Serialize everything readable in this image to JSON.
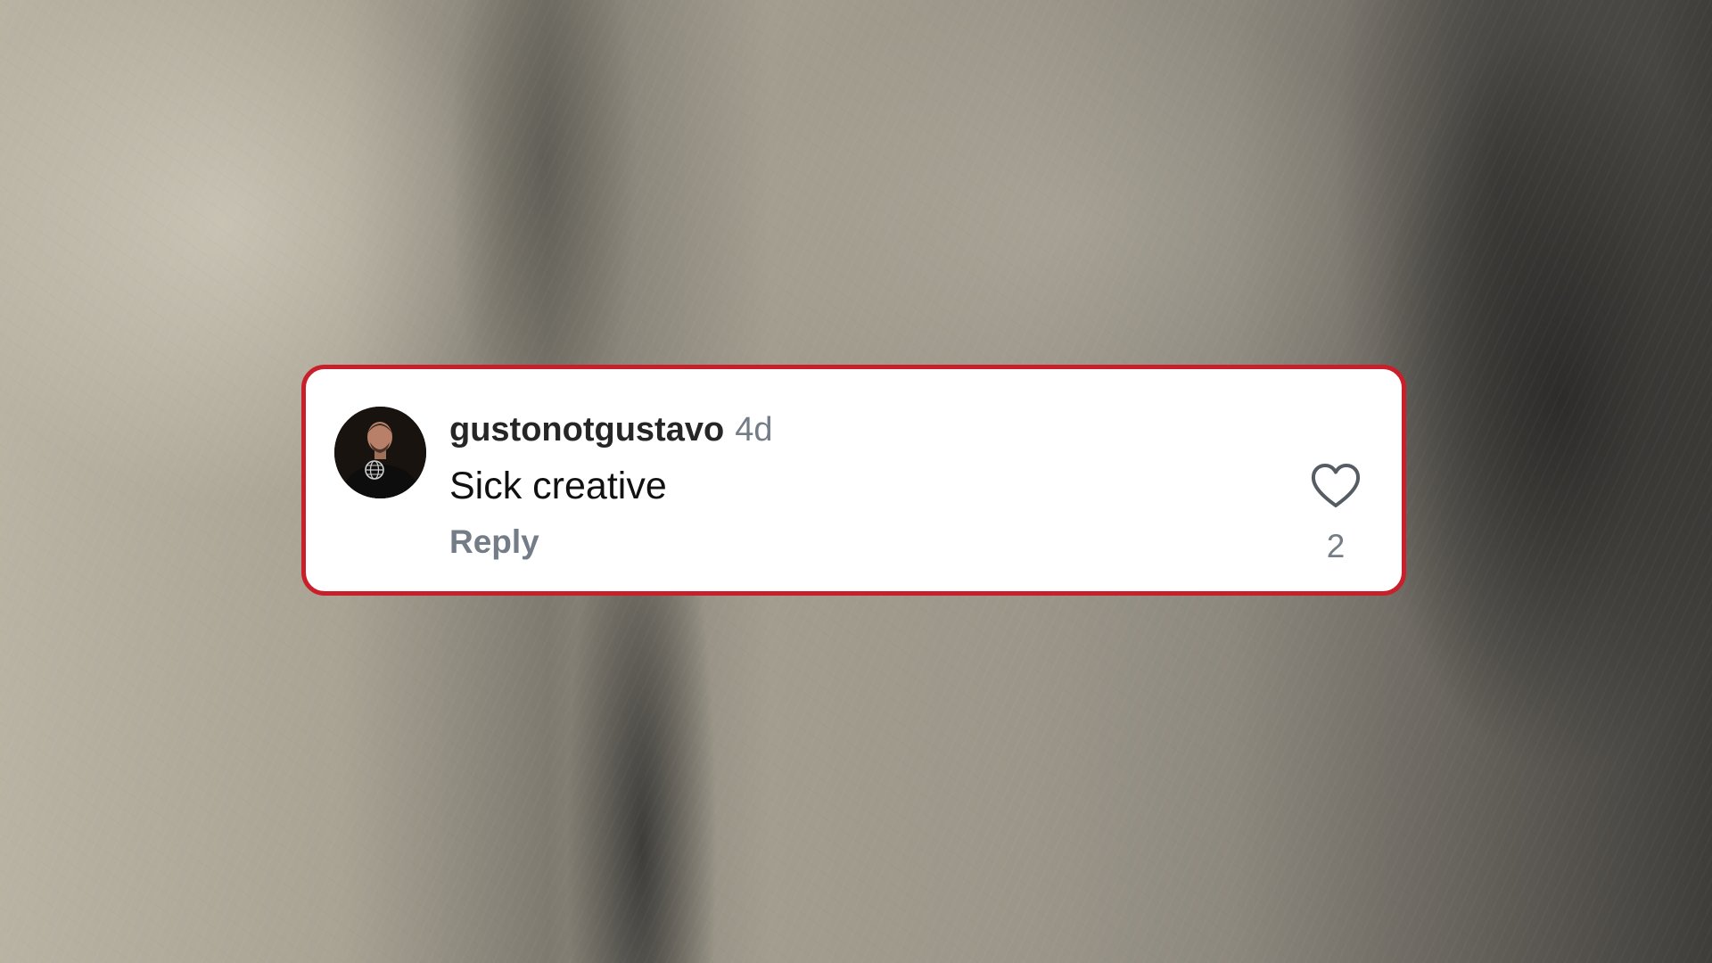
{
  "comment": {
    "username": "gustonotgustavo",
    "timestamp": "4d",
    "text": "Sick creative",
    "reply_label": "Reply",
    "like_count": "2",
    "avatar": "profile-photo"
  },
  "colors": {
    "card_border": "#c91f2a",
    "card_background": "#ffffff",
    "username": "#262626",
    "secondary_text": "#737c87",
    "comment_text": "#111111"
  },
  "icons": {
    "like": "heart-outline-icon"
  }
}
